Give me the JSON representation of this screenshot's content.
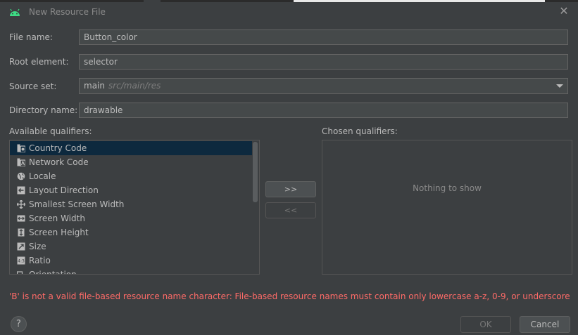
{
  "window": {
    "title": "New Resource File",
    "close_glyph": "✕"
  },
  "form": {
    "file_name_label": "File name:",
    "file_name_value": "Button_color",
    "root_element_label": "Root element:",
    "root_element_value": "selector",
    "source_set_label": "Source set:",
    "source_set_value": "main",
    "source_set_hint": "src/main/res",
    "directory_name_label": "Directory name:",
    "directory_name_value": "drawable"
  },
  "qualifiers": {
    "available_label": "Available qualifiers:",
    "chosen_label": "Chosen qualifiers:",
    "empty_text": "Nothing to show",
    "add_button": ">>",
    "remove_button": "<<",
    "items": [
      {
        "label": "Country Code",
        "icon": "country-code-icon",
        "selected": true
      },
      {
        "label": "Network Code",
        "icon": "network-code-icon",
        "selected": false
      },
      {
        "label": "Locale",
        "icon": "globe-icon",
        "selected": false
      },
      {
        "label": "Layout Direction",
        "icon": "layout-direction-icon",
        "selected": false
      },
      {
        "label": "Smallest Screen Width",
        "icon": "smallest-screen-width-icon",
        "selected": false
      },
      {
        "label": "Screen Width",
        "icon": "screen-width-icon",
        "selected": false
      },
      {
        "label": "Screen Height",
        "icon": "screen-height-icon",
        "selected": false
      },
      {
        "label": "Size",
        "icon": "size-icon",
        "selected": false
      },
      {
        "label": "Ratio",
        "icon": "ratio-icon",
        "selected": false
      },
      {
        "label": "Orientation",
        "icon": "orientation-icon",
        "selected": false
      }
    ]
  },
  "error": "'B' is not a valid file-based resource name character: File-based resource names must contain only lowercase a-z, 0-9, or underscore",
  "footer": {
    "help_label": "?",
    "ok_label": "OK",
    "cancel_label": "Cancel"
  },
  "colors": {
    "background": "#3c3f41",
    "selection": "#0d293e",
    "error": "#ff6b68",
    "android_green": "#3ddc84"
  }
}
